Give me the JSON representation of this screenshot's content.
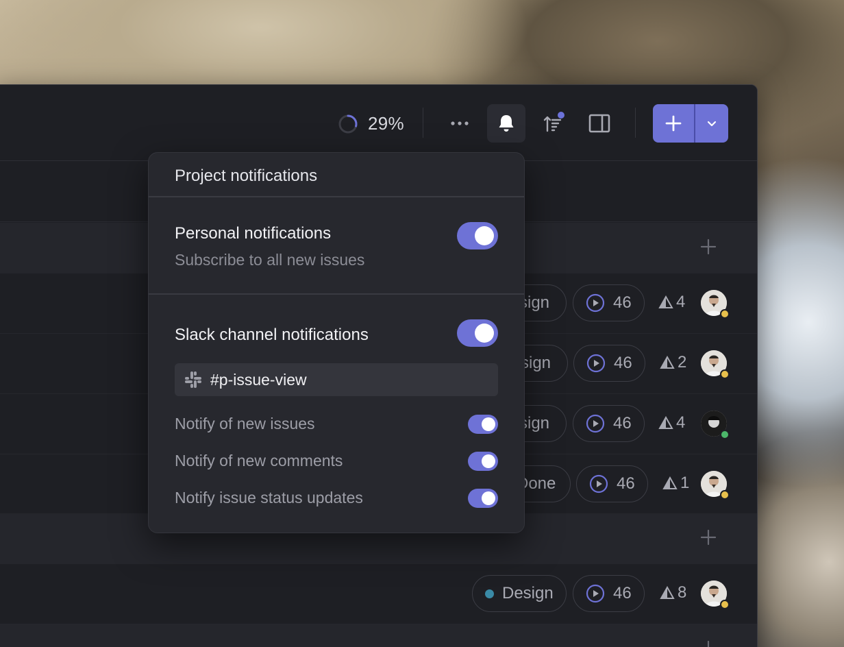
{
  "toolbar": {
    "progress_percent": 29,
    "progress_text": "29%",
    "buttons": {
      "more": "more-horizontal-icon",
      "notifications": "bell-icon",
      "sort": "sort-icon",
      "panel": "sidebar-panel-icon",
      "new": "plus-icon",
      "new_menu": "chevron-down-icon"
    },
    "colors": {
      "accent": "#6e72d6",
      "notify_dot": "#6c72d9"
    }
  },
  "rows": [
    {
      "label": "Design",
      "label_partial": "sign",
      "estimate": "46",
      "priority": "4",
      "status_color": "#e8c04c"
    },
    {
      "label": "Design",
      "label_partial": "sign",
      "estimate": "46",
      "priority": "2",
      "status_color": "#e8c04c"
    },
    {
      "label": "Design",
      "label_partial": "sign",
      "estimate": "46",
      "priority": "4",
      "status_color": "#4cb66a"
    },
    {
      "label": "Done",
      "label_partial": "Done",
      "estimate": "46",
      "priority": "1",
      "status_color": "#e8c04c"
    },
    {
      "label": "Design",
      "label_partial": "Design",
      "estimate": "46",
      "priority": "8",
      "status_color": "#e8c04c"
    }
  ],
  "popover": {
    "title": "Project notifications",
    "personal": {
      "title": "Personal notifications",
      "subtitle": "Subscribe to all new issues",
      "enabled": true
    },
    "slack": {
      "title": "Slack channel notifications",
      "enabled": true,
      "channel": "#p-issue-view",
      "options": [
        {
          "label": "Notify of new issues",
          "enabled": true
        },
        {
          "label": "Notify of new comments",
          "enabled": true
        },
        {
          "label": "Notify issue status updates",
          "enabled": true
        }
      ]
    }
  }
}
